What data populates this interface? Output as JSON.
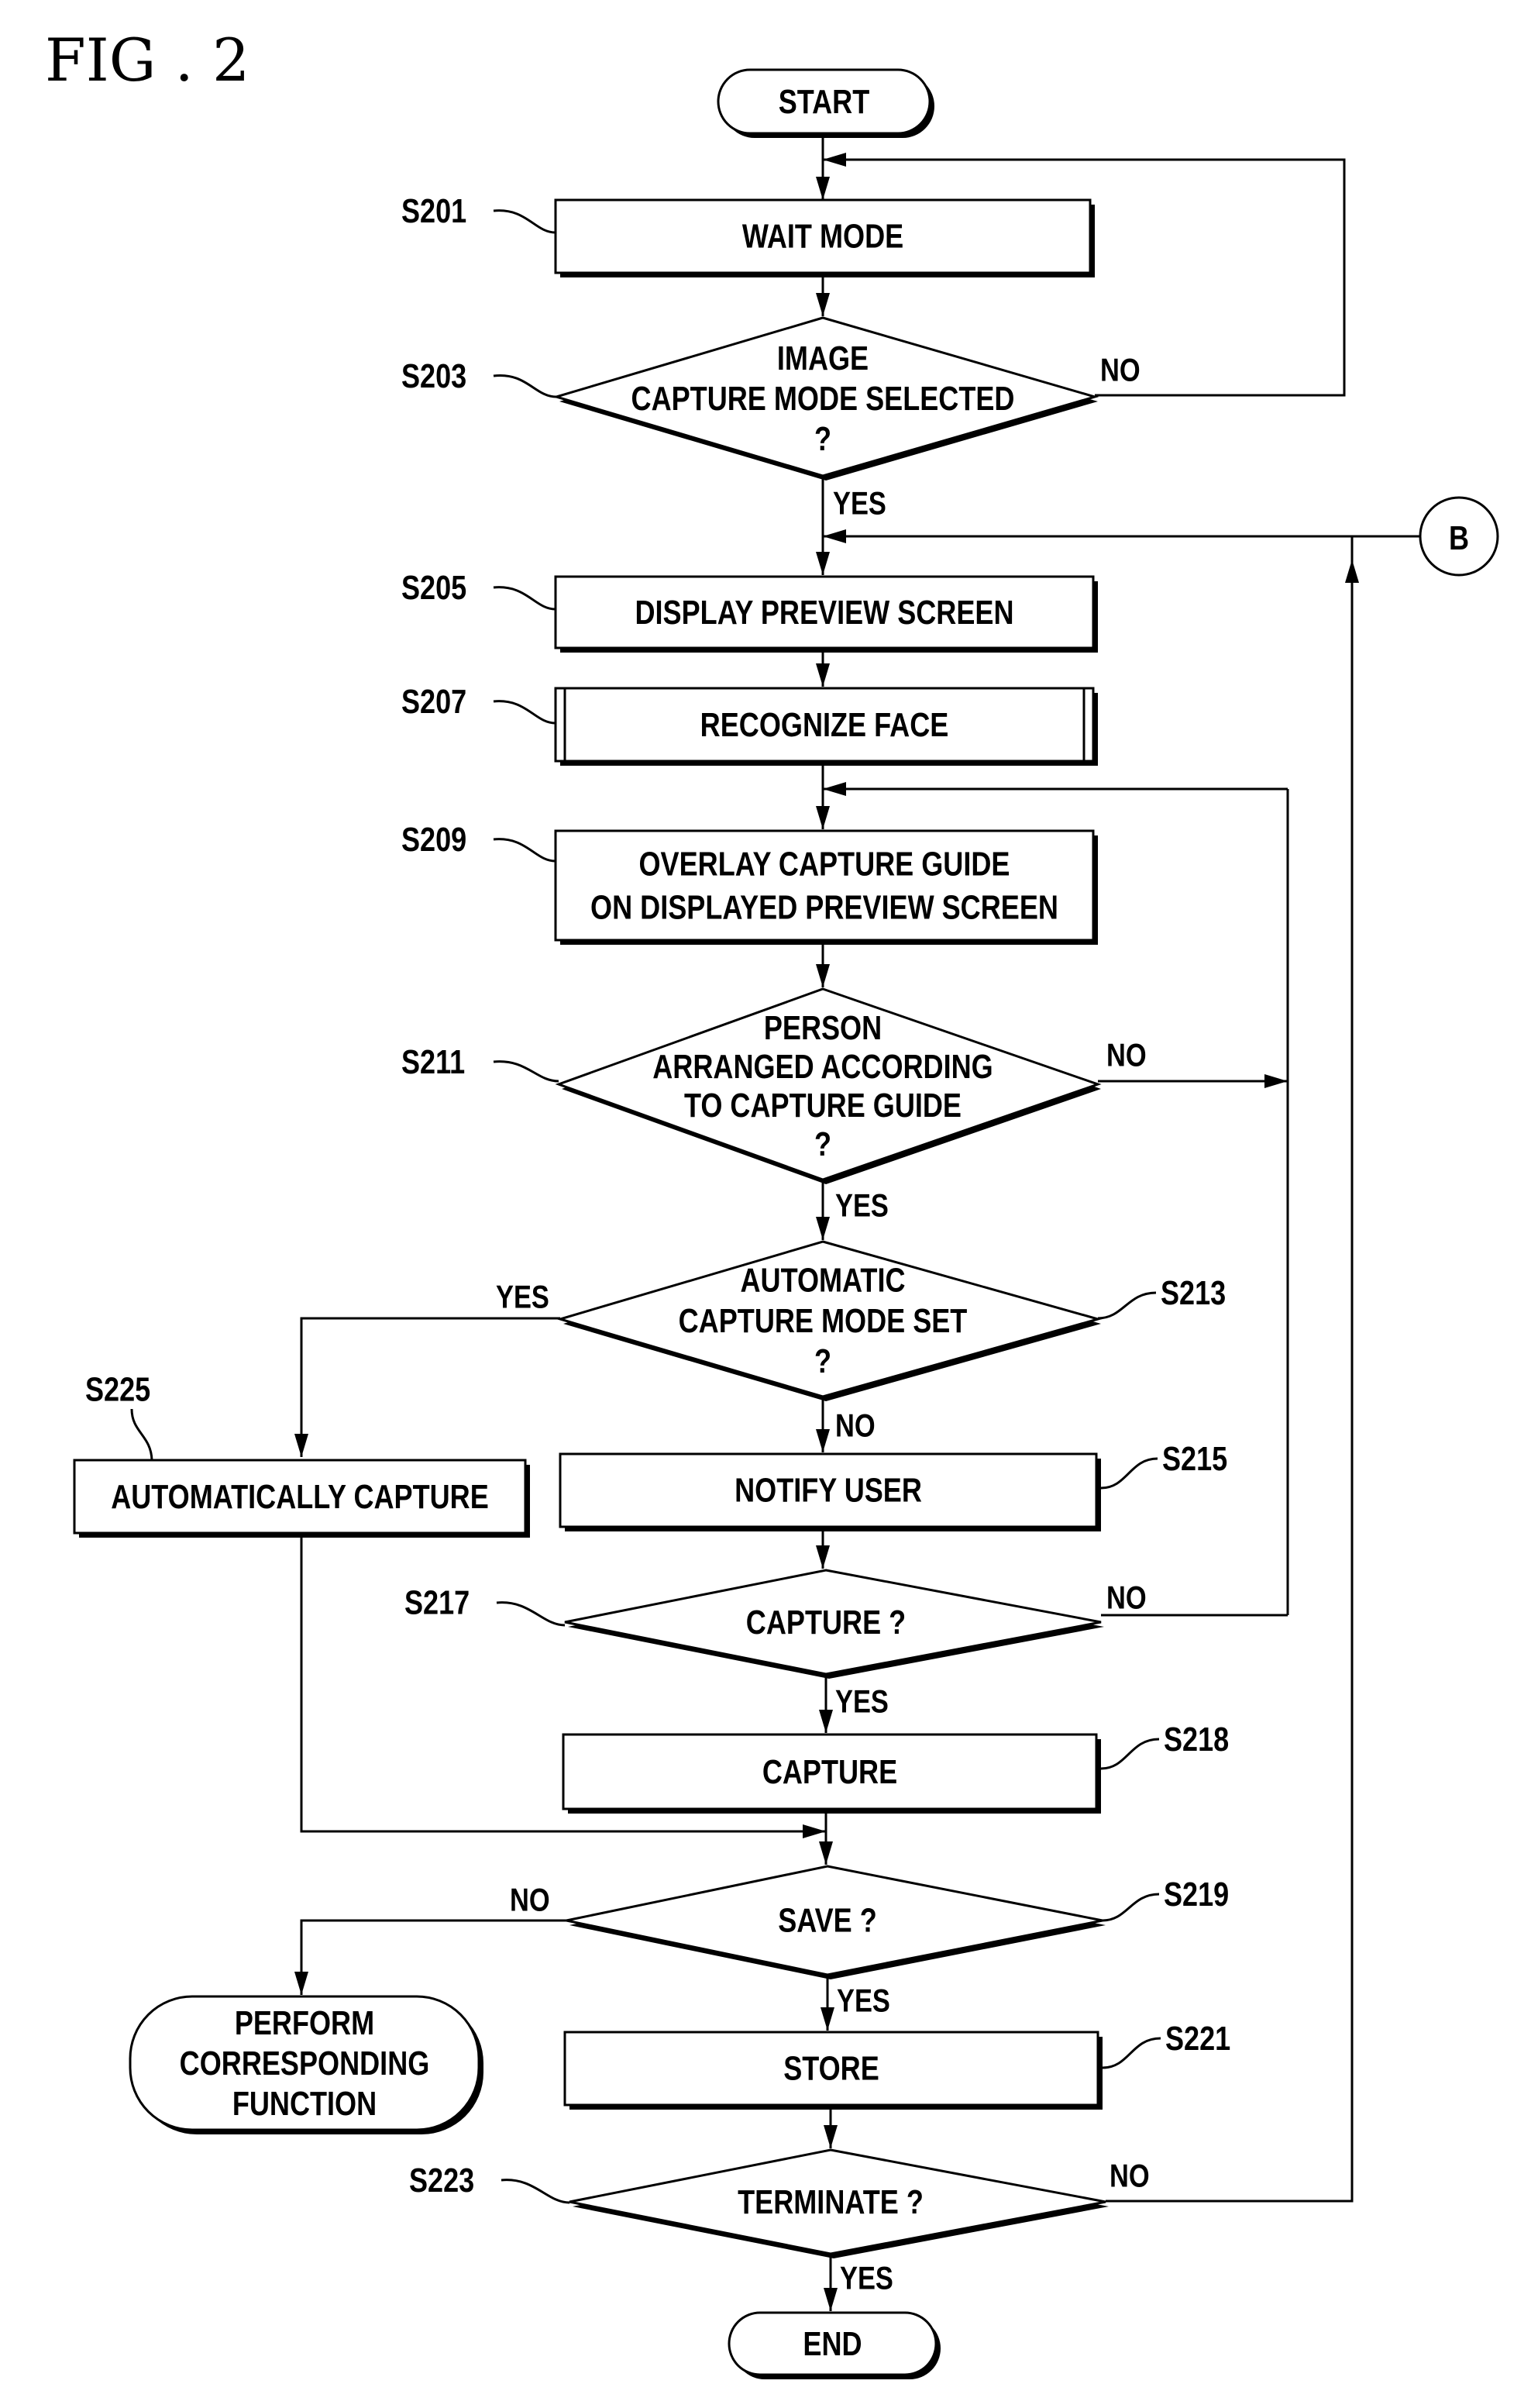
{
  "figure": {
    "title": "FIG . 2"
  },
  "nodes": {
    "start": {
      "label": "START"
    },
    "s201": {
      "step": "S201",
      "lines": [
        "WAIT MODE"
      ]
    },
    "s203": {
      "step": "S203",
      "lines": [
        "IMAGE",
        "CAPTURE MODE SELECTED",
        "?"
      ]
    },
    "connector_b": {
      "label": "B"
    },
    "s205": {
      "step": "S205",
      "lines": [
        "DISPLAY PREVIEW SCREEN"
      ]
    },
    "s207": {
      "step": "S207",
      "lines": [
        "RECOGNIZE FACE"
      ]
    },
    "s209": {
      "step": "S209",
      "lines": [
        "OVERLAY CAPTURE GUIDE",
        "ON DISPLAYED PREVIEW SCREEN"
      ]
    },
    "s211": {
      "step": "S211",
      "lines": [
        "PERSON",
        "ARRANGED ACCORDING",
        "TO CAPTURE GUIDE",
        "?"
      ]
    },
    "s213": {
      "step": "S213",
      "lines": [
        "AUTOMATIC",
        "CAPTURE MODE SET",
        "?"
      ]
    },
    "s225": {
      "step": "S225",
      "lines": [
        "AUTOMATICALLY CAPTURE"
      ]
    },
    "s215": {
      "step": "S215",
      "lines": [
        "NOTIFY USER"
      ]
    },
    "s217": {
      "step": "S217",
      "lines": [
        "CAPTURE ?"
      ]
    },
    "s218": {
      "step": "S218",
      "lines": [
        "CAPTURE"
      ]
    },
    "s219": {
      "step": "S219",
      "lines": [
        "SAVE ?"
      ]
    },
    "perform": {
      "lines": [
        "PERFORM",
        "CORRESPONDING",
        "FUNCTION"
      ]
    },
    "s221": {
      "step": "S221",
      "lines": [
        "STORE"
      ]
    },
    "s223": {
      "step": "S223",
      "lines": [
        "TERMINATE ?"
      ]
    },
    "end": {
      "label": "END"
    }
  },
  "branches": {
    "s203_no": "NO",
    "s203_yes": "YES",
    "s211_no": "NO",
    "s211_yes": "YES",
    "s213_yes": "YES",
    "s213_no": "NO",
    "s217_no": "NO",
    "s217_yes": "YES",
    "s219_no": "NO",
    "s219_yes": "YES",
    "s223_no": "NO",
    "s223_yes": "YES"
  }
}
